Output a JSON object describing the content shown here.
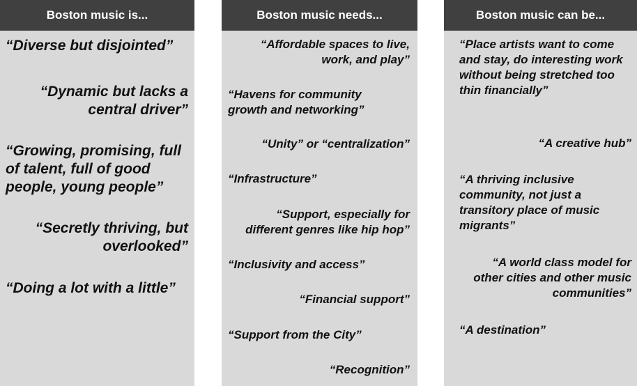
{
  "columns": [
    {
      "header": "Boston music is...",
      "quotes": [
        "“Diverse but disjointed”",
        "“Dynamic but lacks a central driver”",
        "“Growing, promising, full of talent, full of good people, young people”",
        "“Secretly thriving, but overlooked”",
        "“Doing a lot with a little”"
      ]
    },
    {
      "header": "Boston music needs...",
      "quotes": [
        "“Affordable spaces to live, work, and play”",
        "“Havens for community growth and networking”",
        "“Unity” or “centralization”",
        "“Infrastructure”",
        "“Support, especially for different genres like hip hop”",
        "“Inclusivity and access”",
        "“Financial support”",
        "“Support from the City”",
        "“Recognition”"
      ]
    },
    {
      "header": "Boston music can be...",
      "quotes": [
        "“Place artists want to come and stay, do interesting work without being stretched too thin financially”",
        "“A creative hub”",
        "“A thriving inclusive community, not just a transitory place of music migrants”",
        "“A world class model for other cities and other music communities”",
        "“A destination”"
      ]
    }
  ]
}
